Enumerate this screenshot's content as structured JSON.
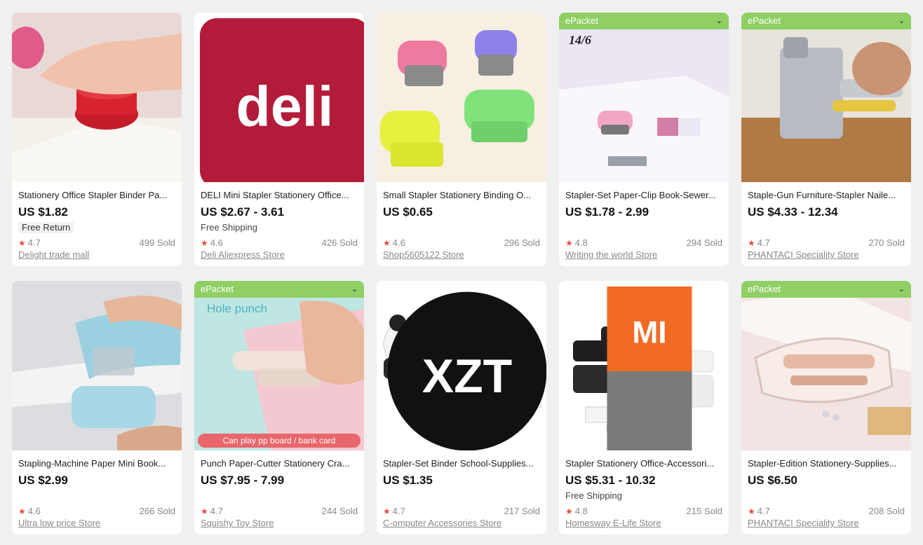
{
  "colors": {
    "epacket": "#8fcf63",
    "star": "#e84c3d",
    "background": "#f0f0f0"
  },
  "products": [
    {
      "title": "Stationery Office Stapler Binder Pa...",
      "price": "US $1.82",
      "shipping": "",
      "tag": "Free Return",
      "epacket": "",
      "rating": "4.7",
      "sold": "499 Sold",
      "store": "Delight trade mall",
      "badge": ""
    },
    {
      "title": "DELI Mini Stapler Stationery Office...",
      "price": "US $2.67 - 3.61",
      "shipping": "Free Shipping",
      "tag": "",
      "epacket": "",
      "rating": "4.6",
      "sold": "426 Sold",
      "store": "Deli Aliexpress Store",
      "badge": "deli"
    },
    {
      "title": "Small Stapler Stationery Binding O...",
      "price": "US $0.65",
      "shipping": "",
      "tag": "",
      "epacket": "",
      "rating": "4.6",
      "sold": "296 Sold",
      "store": "Shop5605122 Store",
      "badge": ""
    },
    {
      "title": "Stapler-Set Paper-Clip Book-Sewer...",
      "price": "US $1.78 - 2.99",
      "shipping": "",
      "tag": "",
      "epacket": "ePacket",
      "rating": "4.8",
      "sold": "294 Sold",
      "store": "Writing the world Store",
      "badge": "",
      "image_text": "14/6"
    },
    {
      "title": "Staple-Gun Furniture-Stapler Naile...",
      "price": "US $4.33 - 12.34",
      "shipping": "",
      "tag": "",
      "epacket": "ePacket",
      "rating": "4.7",
      "sold": "270 Sold",
      "store": "PHANTACI Speciality Store",
      "badge": ""
    },
    {
      "title": "Stapling-Machine Paper Mini Book...",
      "price": "US $2.99",
      "shipping": "",
      "tag": "",
      "epacket": "",
      "rating": "4.6",
      "sold": "266 Sold",
      "store": "Ultra low price Store",
      "badge": ""
    },
    {
      "title": "Punch Paper-Cutter Stationery Cra...",
      "price": "US $7.95 - 7.99",
      "shipping": "",
      "tag": "",
      "epacket": "ePacket",
      "rating": "4.7",
      "sold": "244 Sold",
      "store": "Squishy Toy Store",
      "badge": "",
      "image_text": "Hole punch",
      "image_banner": "Can play pp board / bank card"
    },
    {
      "title": "Stapler-Set Binder School-Supplies...",
      "price": "US $1.35",
      "shipping": "",
      "tag": "",
      "epacket": "",
      "rating": "4.7",
      "sold": "217 Sold",
      "store": "C-omputer Accessories Store",
      "badge": "XZT"
    },
    {
      "title": "Stapler Stationery Office-Accessori...",
      "price": "US $5.31 - 10.32",
      "shipping": "Free Shipping",
      "tag": "",
      "epacket": "",
      "rating": "4.8",
      "sold": "215 Sold",
      "store": "Homesway E-Life Store",
      "badge": "MI"
    },
    {
      "title": "Stapler-Edition Stationery-Supplies...",
      "price": "US $6.50",
      "shipping": "",
      "tag": "",
      "epacket": "ePacket",
      "rating": "4.7",
      "sold": "208 Sold",
      "store": "PHANTACI Speciality Store",
      "badge": ""
    }
  ]
}
